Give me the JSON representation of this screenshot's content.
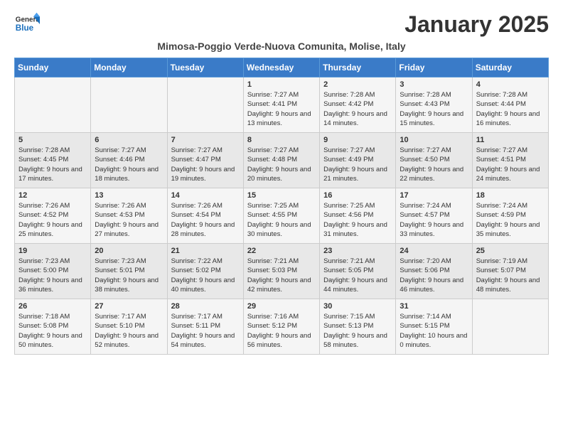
{
  "header": {
    "logo_general": "General",
    "logo_blue": "Blue",
    "month_title": "January 2025",
    "subtitle": "Mimosa-Poggio Verde-Nuova Comunita, Molise, Italy"
  },
  "weekdays": [
    "Sunday",
    "Monday",
    "Tuesday",
    "Wednesday",
    "Thursday",
    "Friday",
    "Saturday"
  ],
  "weeks": [
    [
      {
        "day": "",
        "sunrise": "",
        "sunset": "",
        "daylight": ""
      },
      {
        "day": "",
        "sunrise": "",
        "sunset": "",
        "daylight": ""
      },
      {
        "day": "",
        "sunrise": "",
        "sunset": "",
        "daylight": ""
      },
      {
        "day": "1",
        "sunrise": "Sunrise: 7:27 AM",
        "sunset": "Sunset: 4:41 PM",
        "daylight": "Daylight: 9 hours and 13 minutes."
      },
      {
        "day": "2",
        "sunrise": "Sunrise: 7:28 AM",
        "sunset": "Sunset: 4:42 PM",
        "daylight": "Daylight: 9 hours and 14 minutes."
      },
      {
        "day": "3",
        "sunrise": "Sunrise: 7:28 AM",
        "sunset": "Sunset: 4:43 PM",
        "daylight": "Daylight: 9 hours and 15 minutes."
      },
      {
        "day": "4",
        "sunrise": "Sunrise: 7:28 AM",
        "sunset": "Sunset: 4:44 PM",
        "daylight": "Daylight: 9 hours and 16 minutes."
      }
    ],
    [
      {
        "day": "5",
        "sunrise": "Sunrise: 7:28 AM",
        "sunset": "Sunset: 4:45 PM",
        "daylight": "Daylight: 9 hours and 17 minutes."
      },
      {
        "day": "6",
        "sunrise": "Sunrise: 7:27 AM",
        "sunset": "Sunset: 4:46 PM",
        "daylight": "Daylight: 9 hours and 18 minutes."
      },
      {
        "day": "7",
        "sunrise": "Sunrise: 7:27 AM",
        "sunset": "Sunset: 4:47 PM",
        "daylight": "Daylight: 9 hours and 19 minutes."
      },
      {
        "day": "8",
        "sunrise": "Sunrise: 7:27 AM",
        "sunset": "Sunset: 4:48 PM",
        "daylight": "Daylight: 9 hours and 20 minutes."
      },
      {
        "day": "9",
        "sunrise": "Sunrise: 7:27 AM",
        "sunset": "Sunset: 4:49 PM",
        "daylight": "Daylight: 9 hours and 21 minutes."
      },
      {
        "day": "10",
        "sunrise": "Sunrise: 7:27 AM",
        "sunset": "Sunset: 4:50 PM",
        "daylight": "Daylight: 9 hours and 22 minutes."
      },
      {
        "day": "11",
        "sunrise": "Sunrise: 7:27 AM",
        "sunset": "Sunset: 4:51 PM",
        "daylight": "Daylight: 9 hours and 24 minutes."
      }
    ],
    [
      {
        "day": "12",
        "sunrise": "Sunrise: 7:26 AM",
        "sunset": "Sunset: 4:52 PM",
        "daylight": "Daylight: 9 hours and 25 minutes."
      },
      {
        "day": "13",
        "sunrise": "Sunrise: 7:26 AM",
        "sunset": "Sunset: 4:53 PM",
        "daylight": "Daylight: 9 hours and 27 minutes."
      },
      {
        "day": "14",
        "sunrise": "Sunrise: 7:26 AM",
        "sunset": "Sunset: 4:54 PM",
        "daylight": "Daylight: 9 hours and 28 minutes."
      },
      {
        "day": "15",
        "sunrise": "Sunrise: 7:25 AM",
        "sunset": "Sunset: 4:55 PM",
        "daylight": "Daylight: 9 hours and 30 minutes."
      },
      {
        "day": "16",
        "sunrise": "Sunrise: 7:25 AM",
        "sunset": "Sunset: 4:56 PM",
        "daylight": "Daylight: 9 hours and 31 minutes."
      },
      {
        "day": "17",
        "sunrise": "Sunrise: 7:24 AM",
        "sunset": "Sunset: 4:57 PM",
        "daylight": "Daylight: 9 hours and 33 minutes."
      },
      {
        "day": "18",
        "sunrise": "Sunrise: 7:24 AM",
        "sunset": "Sunset: 4:59 PM",
        "daylight": "Daylight: 9 hours and 35 minutes."
      }
    ],
    [
      {
        "day": "19",
        "sunrise": "Sunrise: 7:23 AM",
        "sunset": "Sunset: 5:00 PM",
        "daylight": "Daylight: 9 hours and 36 minutes."
      },
      {
        "day": "20",
        "sunrise": "Sunrise: 7:23 AM",
        "sunset": "Sunset: 5:01 PM",
        "daylight": "Daylight: 9 hours and 38 minutes."
      },
      {
        "day": "21",
        "sunrise": "Sunrise: 7:22 AM",
        "sunset": "Sunset: 5:02 PM",
        "daylight": "Daylight: 9 hours and 40 minutes."
      },
      {
        "day": "22",
        "sunrise": "Sunrise: 7:21 AM",
        "sunset": "Sunset: 5:03 PM",
        "daylight": "Daylight: 9 hours and 42 minutes."
      },
      {
        "day": "23",
        "sunrise": "Sunrise: 7:21 AM",
        "sunset": "Sunset: 5:05 PM",
        "daylight": "Daylight: 9 hours and 44 minutes."
      },
      {
        "day": "24",
        "sunrise": "Sunrise: 7:20 AM",
        "sunset": "Sunset: 5:06 PM",
        "daylight": "Daylight: 9 hours and 46 minutes."
      },
      {
        "day": "25",
        "sunrise": "Sunrise: 7:19 AM",
        "sunset": "Sunset: 5:07 PM",
        "daylight": "Daylight: 9 hours and 48 minutes."
      }
    ],
    [
      {
        "day": "26",
        "sunrise": "Sunrise: 7:18 AM",
        "sunset": "Sunset: 5:08 PM",
        "daylight": "Daylight: 9 hours and 50 minutes."
      },
      {
        "day": "27",
        "sunrise": "Sunrise: 7:17 AM",
        "sunset": "Sunset: 5:10 PM",
        "daylight": "Daylight: 9 hours and 52 minutes."
      },
      {
        "day": "28",
        "sunrise": "Sunrise: 7:17 AM",
        "sunset": "Sunset: 5:11 PM",
        "daylight": "Daylight: 9 hours and 54 minutes."
      },
      {
        "day": "29",
        "sunrise": "Sunrise: 7:16 AM",
        "sunset": "Sunset: 5:12 PM",
        "daylight": "Daylight: 9 hours and 56 minutes."
      },
      {
        "day": "30",
        "sunrise": "Sunrise: 7:15 AM",
        "sunset": "Sunset: 5:13 PM",
        "daylight": "Daylight: 9 hours and 58 minutes."
      },
      {
        "day": "31",
        "sunrise": "Sunrise: 7:14 AM",
        "sunset": "Sunset: 5:15 PM",
        "daylight": "Daylight: 10 hours and 0 minutes."
      },
      {
        "day": "",
        "sunrise": "",
        "sunset": "",
        "daylight": ""
      }
    ]
  ]
}
